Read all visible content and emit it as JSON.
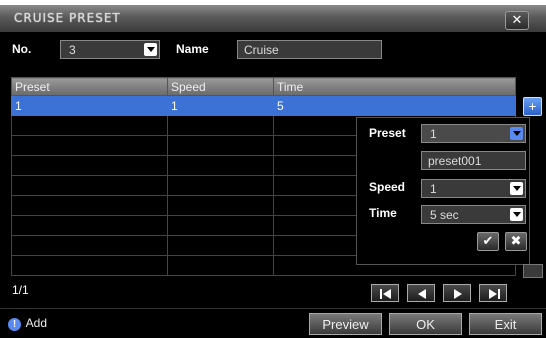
{
  "dialog": {
    "title": "CRUISE PRESET"
  },
  "header": {
    "no_label": "No.",
    "no_value": "3",
    "name_label": "Name",
    "name_value": "Cruise"
  },
  "table": {
    "columns": [
      "Preset",
      "Speed",
      "Time"
    ],
    "rows": [
      {
        "preset": "1",
        "speed": "1",
        "time": "5"
      }
    ]
  },
  "popup": {
    "preset_label": "Preset",
    "preset_value": "1",
    "preset_name": "preset001",
    "speed_label": "Speed",
    "speed_value": "1",
    "time_label": "Time",
    "time_value": "5 sec"
  },
  "pagination": {
    "text": "1/1"
  },
  "status": {
    "text": "Add"
  },
  "buttons": {
    "preview": "Preview",
    "ok": "OK",
    "exit": "Exit"
  },
  "colors": {
    "selected_row": "#3c72d6",
    "background": "#000000"
  },
  "icons": {
    "close": "close-icon",
    "add": "plus-icon",
    "confirm": "check-icon",
    "cancel": "x-icon",
    "info": "info-icon",
    "first": "first-page-icon",
    "prev": "prev-page-icon",
    "next": "next-page-icon",
    "last": "last-page-icon"
  }
}
